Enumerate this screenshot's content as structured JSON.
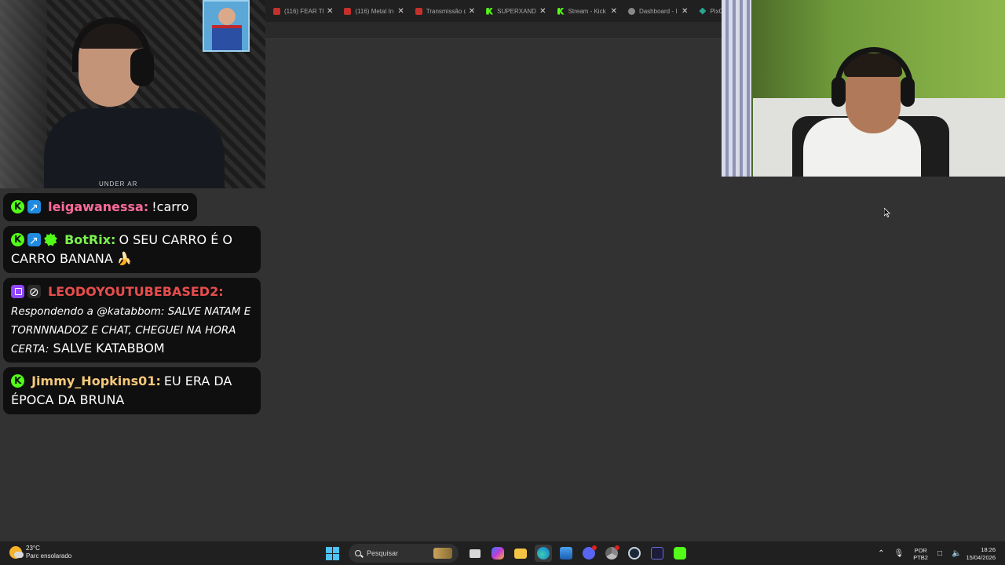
{
  "browser": {
    "tabs": [
      {
        "label": "(116) FEAR TH",
        "icon": "youtube-icon"
      },
      {
        "label": "(116) Metal In",
        "icon": "youtube-icon"
      },
      {
        "label": "Transmissão d",
        "icon": "youtube-icon"
      },
      {
        "label": "SUPERXANDÃ",
        "icon": "kick-icon"
      },
      {
        "label": "Stream - Kick",
        "icon": "kick-icon"
      },
      {
        "label": "Dashboard - I",
        "icon": "globe-icon"
      },
      {
        "label": "PixGG",
        "icon": "pixgg-icon"
      }
    ],
    "close_glyph": "✕"
  },
  "chat": {
    "messages": [
      {
        "username": "leigawanessa:",
        "username_color": "#ff6b9a",
        "text": "!carro",
        "badges": [
          "kick",
          "mod"
        ]
      },
      {
        "username": "BotRix:",
        "username_color": "#7cf24f",
        "text": "O SEU CARRO É O CARRO BANANA 🍌",
        "badges": [
          "kick",
          "mod",
          "verified"
        ]
      },
      {
        "username": "LEODOYOUTUBEBASED2:",
        "username_color": "#e84d4d",
        "reply_prefix": "Respondendo a @katabbom: SALVE NATAM E TORNNNADOZ E CHAT, CHEGUEI NA HORA CERTA:",
        "text": "SALVE KATABBOM",
        "badges": [
          "twitch",
          "hidden"
        ]
      },
      {
        "username": "Jimmy_Hopkins01:",
        "username_color": "#f6c87a",
        "text": "EU ERA DA ÉPOCA DA BRUNA",
        "badges": [
          "kick"
        ]
      }
    ]
  },
  "taskbar": {
    "weather_temp": "23°C",
    "weather_desc": "Parc ensolarado",
    "search_placeholder": "Pesquisar",
    "lang_top": "POR",
    "lang_bottom": "PTB2",
    "time": "18:26",
    "date": "15/04/2026"
  },
  "colors": {
    "kick_green": "#53fc18",
    "twitch_purple": "#9146ff",
    "windows_blue": "#4cc2ff"
  }
}
